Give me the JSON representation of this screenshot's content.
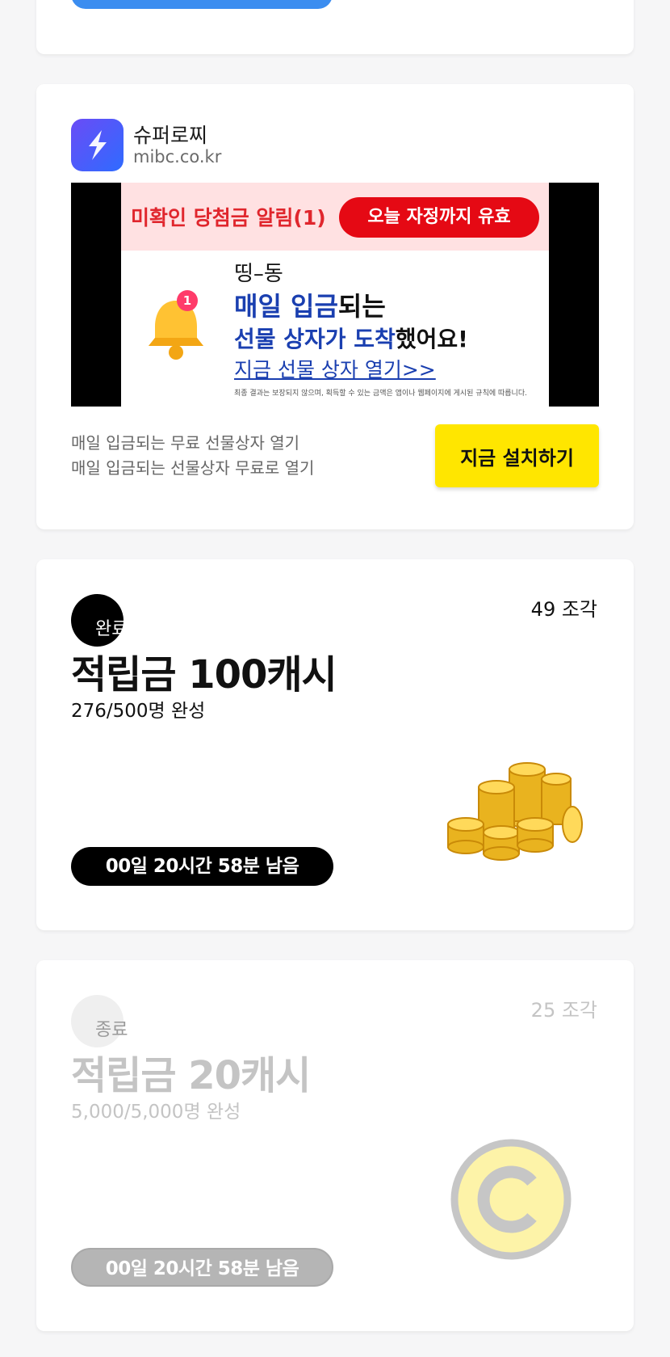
{
  "ad": {
    "app_name": "슈퍼로찌",
    "app_url": "mibc.co.kr",
    "banner": {
      "alert_title": "미확인 당첨금 알림(1)",
      "valid_label": "오늘 자정까지 유효",
      "badge_count": "1",
      "dingdong": "띵–동",
      "line1_highlight": "매일 입금",
      "line1_rest": "되는",
      "line2_highlight": "선물 상자가 도착",
      "line2_rest": "했어요!",
      "line3": "지금 선물 상자 열기>>",
      "disclaimer": "최종 결과는 보장되지 않으며, 획득할 수 있는 금액은 앱이나 웹페이지에 게시된 규칙에 따릅니다."
    },
    "desc_line1": "매일 입금되는 무료 선물상자 열기",
    "desc_line2": "매일 입금되는 선물상자 무료로 열기",
    "install_label": "지금 설치하기"
  },
  "rewards": [
    {
      "status": "완료",
      "pieces": "49 조각",
      "title": "적립금 100캐시",
      "participants": "276/500명 완성",
      "timer": "00일 20시간 58분 남음",
      "image": "gold-coins-icon"
    },
    {
      "status": "종료",
      "pieces": "25 조각",
      "title": "적립금 20캐시",
      "participants": "5,000/5,000명 완성",
      "timer": "00일 20시간 58분 남음",
      "image": "cash-coin-icon"
    }
  ],
  "colors": {
    "install_button": "#ffe600",
    "alert_red": "#e50914",
    "highlight_blue": "#1a3fb0",
    "top_button_blue": "#3b8df0"
  }
}
